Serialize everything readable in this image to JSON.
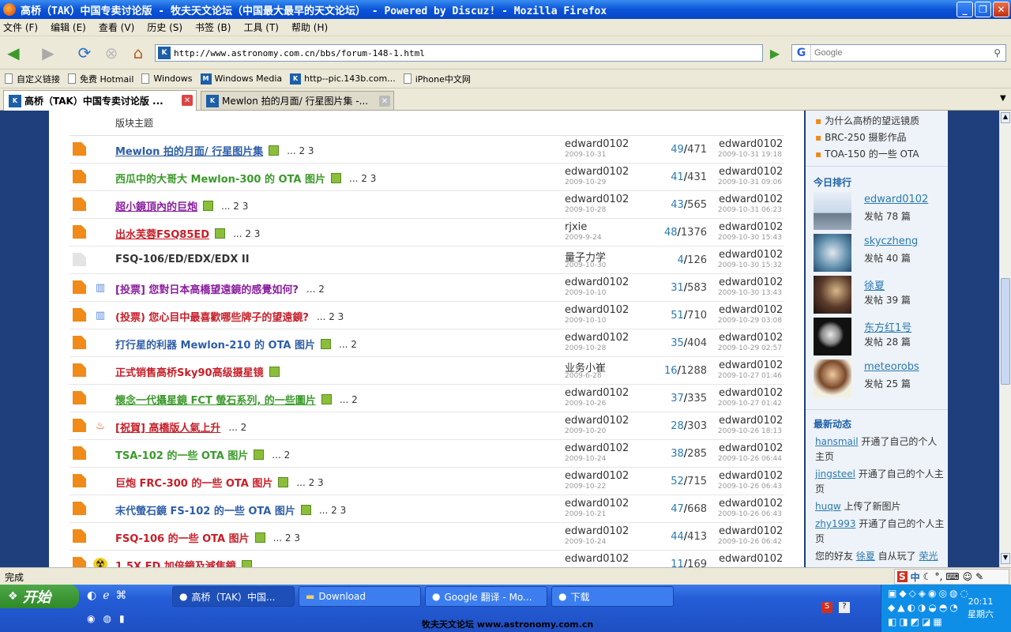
{
  "window": {
    "title": "高桥（TAK）中国专卖讨论版 - 牧夫天文论坛（中国最大最早的天文论坛） - Powered by Discuz! - Mozilla Firefox"
  },
  "menu": [
    "文件 (F)",
    "编辑 (E)",
    "查看 (V)",
    "历史 (S)",
    "书签 (B)",
    "工具 (T)",
    "帮助 (H)"
  ],
  "url": "http://www.astronomy.com.cn/bbs/forum-148-1.html",
  "search": {
    "placeholder": "Google"
  },
  "bookmarks": [
    "自定义链接",
    "免费 Hotmail",
    "Windows",
    "Windows Media",
    "http--pic.143b.com...",
    "iPhone中文网"
  ],
  "tabs": [
    {
      "label": "高桥（TAK）中国专卖讨论版 ..."
    },
    {
      "label": "Mewlon 拍的月面/ 行星图片集 -..."
    }
  ],
  "section_label": "版块主题",
  "threads": [
    {
      "title": "Mewlon 拍的月面/ 行星图片集",
      "color": "#2e5ea8",
      "underline": true,
      "attach": true,
      "pages": "... 2 3",
      "author": "edward0102",
      "date": "2009-10-31",
      "replies": "49",
      "views": "471",
      "last": "edward0102",
      "last_time": "2009-10-31 19:18",
      "icon": "folder",
      "prefix": ""
    },
    {
      "title": "西瓜中的大哥大 Mewlon-300 的 OTA 图片",
      "color": "#3a9a2a",
      "underline": false,
      "attach": true,
      "pages": "... 2 3",
      "author": "edward0102",
      "date": "2009-10-29",
      "replies": "41",
      "views": "431",
      "last": "edward0102",
      "last_time": "2009-10-31 09:06",
      "icon": "folder",
      "prefix": ""
    },
    {
      "title": "超小鏡頂內的巨炮",
      "color": "#8a1fa0",
      "underline": true,
      "attach": true,
      "pages": "... 2 3",
      "author": "edward0102",
      "date": "2009-10-28",
      "replies": "43",
      "views": "565",
      "last": "edward0102",
      "last_time": "2009-10-31 06:23",
      "icon": "folder",
      "prefix": ""
    },
    {
      "title": "出水芙蓉FSQ85ED",
      "color": "#c81e28",
      "underline": true,
      "attach": true,
      "pages": "... 2 3",
      "author": "rjxie",
      "date": "2009-9-24",
      "replies": "48",
      "views": "1376",
      "last": "edward0102",
      "last_time": "2009-10-30 15:43",
      "icon": "folder",
      "prefix": ""
    },
    {
      "title": "FSQ-106/ED/EDX/EDX II",
      "color": "#333333",
      "underline": false,
      "attach": false,
      "pages": "",
      "author": "量子力学",
      "date": "2009-10-30",
      "replies": "4",
      "views": "126",
      "last": "edward0102",
      "last_time": "2009-10-30 15:32",
      "icon": "folder-gray",
      "prefix": ""
    },
    {
      "title": "[投票] 您對日本高橋望遠鏡的感覺如何?",
      "color": "#8a1fa0",
      "underline": false,
      "attach": false,
      "pages": "... 2",
      "author": "edward0102",
      "date": "2009-10-10",
      "replies": "31",
      "views": "583",
      "last": "edward0102",
      "last_time": "2009-10-30 13:43",
      "icon": "folder",
      "prefix": "poll"
    },
    {
      "title": "(投票) 您心目中最喜歡哪些牌子的望遠鏡?",
      "color": "#c81e28",
      "underline": false,
      "attach": false,
      "pages": "... 2 3",
      "author": "edward0102",
      "date": "2009-10-10",
      "replies": "51",
      "views": "710",
      "last": "edward0102",
      "last_time": "2009-10-29 03:08",
      "icon": "folder",
      "prefix": "poll"
    },
    {
      "title": "打行星的利器 Mewlon-210 的 OTA 图片",
      "color": "#2e5ea8",
      "underline": false,
      "attach": true,
      "pages": "... 2",
      "author": "edward0102",
      "date": "2009-10-28",
      "replies": "35",
      "views": "404",
      "last": "edward0102",
      "last_time": "2009-10-29 02:57",
      "icon": "folder",
      "prefix": ""
    },
    {
      "title": "正式销售高桥Sky90高级摄星镜",
      "color": "#c81e28",
      "underline": false,
      "attach": true,
      "pages": "",
      "author": "业务小崔",
      "date": "2009-6-28",
      "replies": "16",
      "views": "1288",
      "last": "edward0102",
      "last_time": "2009-10-27 01:46",
      "icon": "folder",
      "prefix": ""
    },
    {
      "title": "懷念一代攝星鏡 FCT 螢石系列, 的一些圖片",
      "color": "#3a9a2a",
      "underline": true,
      "attach": true,
      "pages": "... 2",
      "author": "edward0102",
      "date": "2009-10-26",
      "replies": "37",
      "views": "335",
      "last": "edward0102",
      "last_time": "2009-10-27 01:42",
      "icon": "folder",
      "prefix": ""
    },
    {
      "title": "[祝賀] 高橋版人氣上升",
      "color": "#c81e28",
      "underline": true,
      "attach": false,
      "pages": "... 2",
      "author": "edward0102",
      "date": "2009-10-20",
      "replies": "28",
      "views": "303",
      "last": "edward0102",
      "last_time": "2009-10-26 18:13",
      "icon": "folder",
      "prefix": "hot"
    },
    {
      "title": "TSA-102 的一些 OTA 图片",
      "color": "#3a9a2a",
      "underline": false,
      "attach": true,
      "pages": "... 2",
      "author": "edward0102",
      "date": "2009-10-24",
      "replies": "38",
      "views": "285",
      "last": "edward0102",
      "last_time": "2009-10-26 06:44",
      "icon": "folder",
      "prefix": ""
    },
    {
      "title": "巨炮 FRC-300 的一些 OTA 图片",
      "color": "#c81e28",
      "underline": false,
      "attach": true,
      "pages": "... 2 3",
      "author": "edward0102",
      "date": "2009-10-22",
      "replies": "52",
      "views": "715",
      "last": "edward0102",
      "last_time": "2009-10-26 06:43",
      "icon": "folder",
      "prefix": ""
    },
    {
      "title": "末代螢石鏡 FS-102 的一些 OTA 图片",
      "color": "#2e5ea8",
      "underline": false,
      "attach": true,
      "pages": "... 2 3",
      "author": "edward0102",
      "date": "2009-10-21",
      "replies": "47",
      "views": "668",
      "last": "edward0102",
      "last_time": "2009-10-26 06:43",
      "icon": "folder",
      "prefix": ""
    },
    {
      "title": "FSQ-106 的一些 OTA 图片",
      "color": "#c81e28",
      "underline": false,
      "attach": true,
      "pages": "... 2 3",
      "author": "edward0102",
      "date": "2009-10-24",
      "replies": "44",
      "views": "413",
      "last": "edward0102",
      "last_time": "2009-10-26 06:42",
      "icon": "folder",
      "prefix": ""
    },
    {
      "title": "1.5X ED 加倍鏡及減焦鏡",
      "color": "#c81e28",
      "underline": false,
      "attach": true,
      "pages": "",
      "author": "edward0102",
      "date": "",
      "replies": "11",
      "views": "169",
      "last": "edward0102",
      "last_time": "",
      "icon": "folder",
      "prefix": "radioactive"
    }
  ],
  "sidebar": {
    "related": [
      "为什么高桥的望远镜质",
      "BRC-250 摄影作品",
      "TOA-150 的一些 OTA"
    ],
    "ranking_title": "今日排行",
    "ranking": [
      {
        "name": "edward0102",
        "posts": "发帖 78 篇"
      },
      {
        "name": "skyczheng",
        "posts": "发帖 40 篇"
      },
      {
        "name": "徐夏",
        "posts": "发帖 39 篇"
      },
      {
        "name": "东方红1号",
        "posts": "发帖 28 篇"
      },
      {
        "name": "meteorobs",
        "posts": "发帖 25 篇"
      }
    ],
    "feed_title": "最新动态",
    "feed": [
      {
        "user": "hansmail",
        "action": " 开通了自己的个人主页"
      },
      {
        "user": "jingsteel",
        "action": " 开通了自己的个人主页"
      },
      {
        "user": "huqw",
        "action": " 上传了新图片"
      },
      {
        "user": "zhy1993",
        "action": " 开通了自己的个人主页"
      }
    ],
    "feed_last": {
      "prefix": "您的好友 ",
      "user": "徐夏",
      "middle": " 自从玩了 ",
      "tail": "荣光"
    }
  },
  "status": "完成",
  "taskbar": {
    "start": "开始",
    "buttons": [
      "高桥（TAK）中国...",
      "Download",
      "Google 翻译 - Mo...",
      "下载"
    ],
    "time": "20:11",
    "day": "星期六",
    "footer": "牧夫天文论坛 www.astronomy.com.cn"
  }
}
